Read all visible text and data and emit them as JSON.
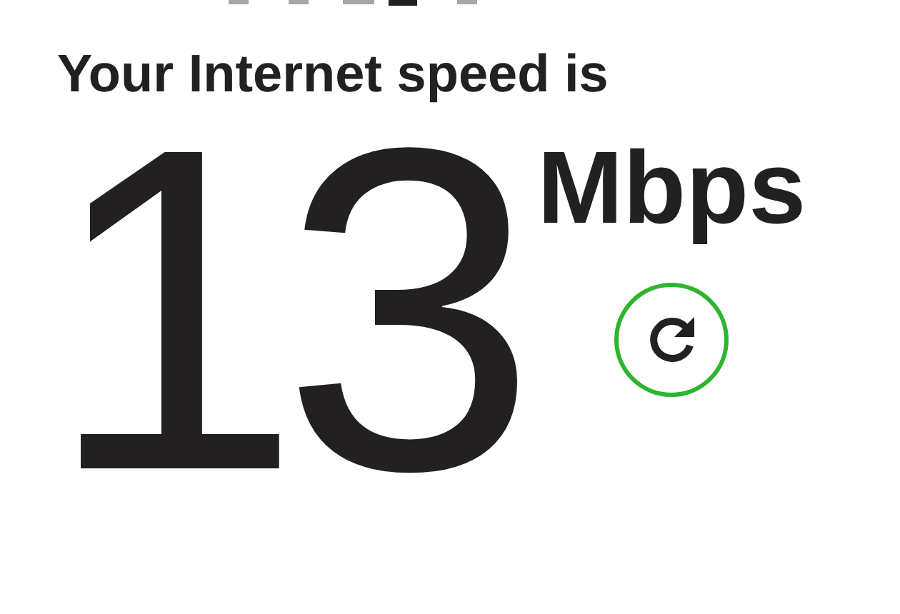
{
  "heading": "Your Internet speed is",
  "speed": {
    "value": "13",
    "unit": "Mbps"
  }
}
